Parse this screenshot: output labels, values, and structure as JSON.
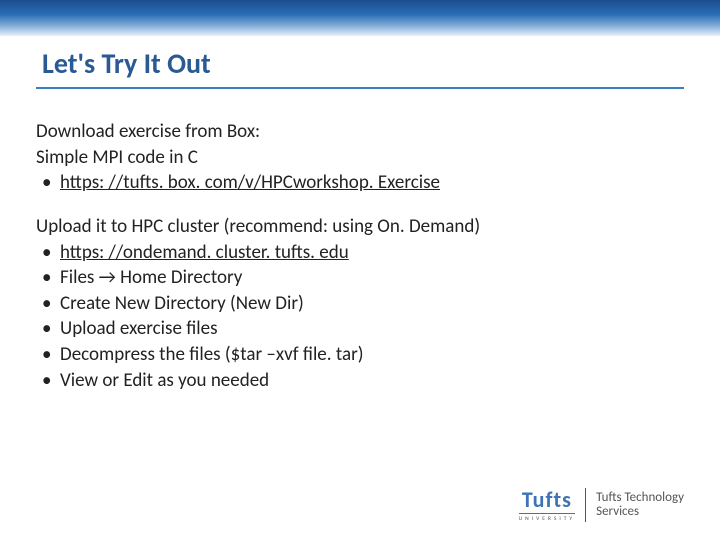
{
  "title": "Let's Try It Out",
  "section1": {
    "line1": "Download exercise from Box:",
    "line2": "Simple MPI code in C",
    "bullets": [
      "https: //tufts. box. com/v/HPCworkshop. Exercise"
    ]
  },
  "section2": {
    "line1": "Upload it to HPC cluster (recommend: using On. Demand)",
    "bullets": [
      "https: //ondemand. cluster. tufts. edu",
      "Files → Home Directory",
      "Create New Directory (New Dir)",
      "Upload exercise files",
      "Decompress the files ($tar –xvf file. tar)",
      "View or Edit as you needed"
    ]
  },
  "logo": {
    "main": "Tufts",
    "sub": "UNIVERSITY",
    "right1": "Tufts Technology",
    "right2": "Services"
  }
}
